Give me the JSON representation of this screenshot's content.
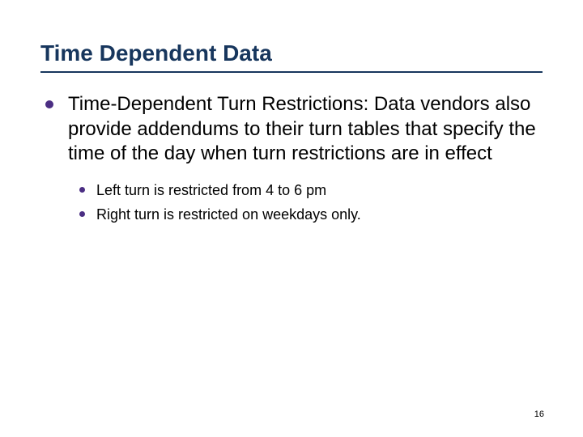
{
  "title": "Time Dependent Data",
  "bullets": [
    {
      "text": "Time-Dependent Turn Restrictions: Data vendors also provide addendums to their turn tables that specify the time of the day when turn restrictions are in effect",
      "sub": [
        {
          "text": "Left turn is restricted from 4 to 6 pm"
        },
        {
          "text": "Right turn is restricted on weekdays only."
        }
      ]
    }
  ],
  "page_number": "16"
}
